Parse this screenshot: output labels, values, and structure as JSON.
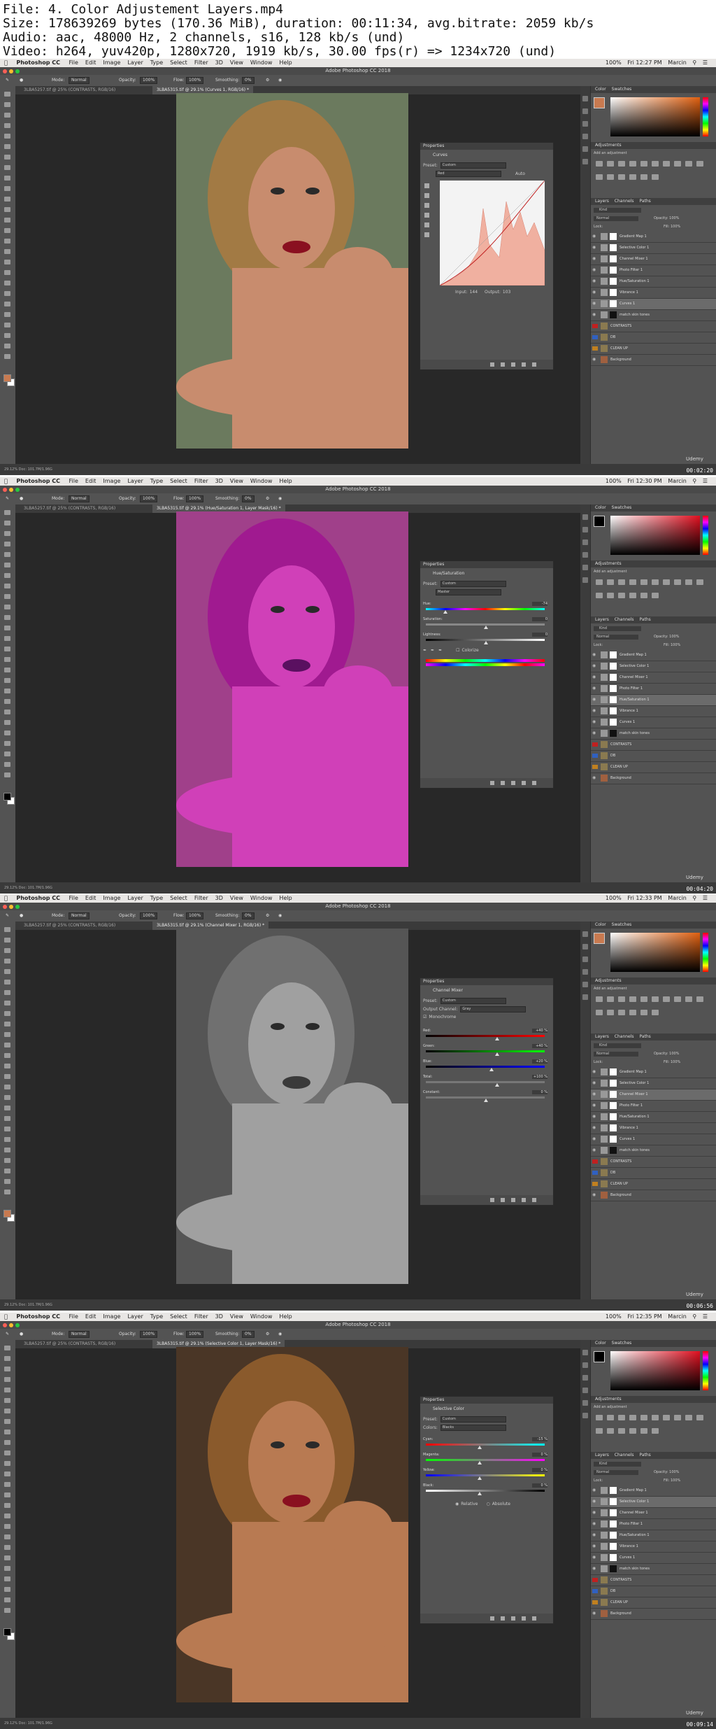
{
  "header": {
    "lines": [
      "File: 4. Color Adjustement Layers.mp4",
      "Size: 178639269 bytes (170.36 MiB), duration: 00:11:34, avg.bitrate: 2059 kb/s",
      "Audio: aac, 48000 Hz, 2 channels, s16, 128 kb/s (und)",
      "Video: h264, yuv420p, 1280x720, 1919 kb/s, 30.00 fps(r) => 1234x720 (und)"
    ]
  },
  "app": {
    "name": "Photoshop CC",
    "window_title": "Adobe Photoshop CC 2018",
    "menus": [
      "File",
      "Edit",
      "Image",
      "Layer",
      "Type",
      "Select",
      "Filter",
      "3D",
      "View",
      "Window",
      "Help"
    ],
    "user": "Marcin",
    "battery": "100%",
    "options": {
      "mode_label": "Mode:",
      "mode_value": "Normal",
      "opacity_label": "Opacity:",
      "opacity_value": "100%",
      "flow_label": "Flow:",
      "flow_value": "100%",
      "smoothing_label": "Smoothing:",
      "smoothing_value": "0%"
    },
    "tab_inactive": "3LBA5257.tif @ 25% (CONTRASTS, RGB/16)",
    "right_tabs": {
      "color": "Color",
      "swatches": "Swatches",
      "adjustments": "Adjustments",
      "add_adjust": "Add an adjustment",
      "layers": "Layers",
      "channels": "Channels",
      "paths": "Paths",
      "kind": "Kind",
      "blend": "Normal",
      "opacity": "Opacity: 100%",
      "lock": "Lock:",
      "fill": "Fill: 100%"
    },
    "status": "29.12%   Doc: 101.7M/1.96G",
    "udemy": "Udemy"
  },
  "frames": [
    {
      "time_menu": "Fri 12:27 PM",
      "tab_active": "3LBA5315.tif @ 29.1% (Curves 1, RGB/16) *",
      "panel_title": "Curves",
      "preset_label": "Preset:",
      "preset_value": "Custom",
      "channel_value": "Red",
      "auto_label": "Auto",
      "input_label": "Input:",
      "input_value": "144",
      "output_label": "Output:",
      "output_value": "103",
      "selected_layer": "Curves 1",
      "timecode": "00:02:20",
      "photo_tint": "natural"
    },
    {
      "time_menu": "Fri 12:30 PM",
      "tab_active": "3LBA5315.tif @ 29.1% (Hue/Saturation 1, Layer Mask/16) *",
      "panel_title": "Hue/Saturation",
      "preset_label": "Preset:",
      "preset_value": "Custom",
      "channel_value": "Master",
      "sliders": [
        {
          "label": "Hue:",
          "value": "-74"
        },
        {
          "label": "Saturation:",
          "value": "0"
        },
        {
          "label": "Lightness:",
          "value": "0"
        }
      ],
      "colorize_label": "Colorize",
      "selected_layer": "Hue/Saturation 1",
      "timecode": "00:04:20",
      "photo_tint": "magenta"
    },
    {
      "time_menu": "Fri 12:33 PM",
      "tab_active": "3LBA5315.tif @ 29.1% (Channel Mixer 1, RGB/16) *",
      "panel_title": "Channel Mixer",
      "preset_label": "Preset:",
      "preset_value": "Custom",
      "output_label": "Output Channel:",
      "output_value": "Gray",
      "monochrome_label": "Monochrome",
      "sliders": [
        {
          "label": "Red:",
          "value": "+40 %"
        },
        {
          "label": "Green:",
          "value": "+40 %"
        },
        {
          "label": "Blue:",
          "value": "+20 %"
        },
        {
          "label": "Total:",
          "value": "+100 %"
        },
        {
          "label": "Constant:",
          "value": "0 %"
        }
      ],
      "selected_layer": "Channel Mixer 1",
      "timecode": "00:06:56",
      "photo_tint": "gray"
    },
    {
      "time_menu": "Fri 12:35 PM",
      "tab_active": "3LBA5315.tif @ 29.1% (Selective Color 1, Layer Mask/16) *",
      "panel_title": "Selective Color",
      "preset_label": "Preset:",
      "preset_value": "Custom",
      "colors_label": "Colors:",
      "colors_value": "Blacks",
      "sliders": [
        {
          "label": "Cyan:",
          "value": "-15 %"
        },
        {
          "label": "Magenta:",
          "value": "0 %"
        },
        {
          "label": "Yellow:",
          "value": "0 %"
        },
        {
          "label": "Black:",
          "value": "0 %"
        }
      ],
      "relative_label": "Relative",
      "absolute_label": "Absolute",
      "selected_layer": "Selective Color 1",
      "timecode": "00:09:14",
      "photo_tint": "warm"
    }
  ],
  "layers": [
    "Gradient Map 1",
    "Selective Color 1",
    "Channel Mixer 1",
    "Photo Filter 1",
    "Hue/Saturation 1",
    "Vibrance 1",
    "Curves 1",
    "match skin tones",
    "CONTRASTS",
    "DB",
    "CLEAN UP",
    "Background"
  ]
}
